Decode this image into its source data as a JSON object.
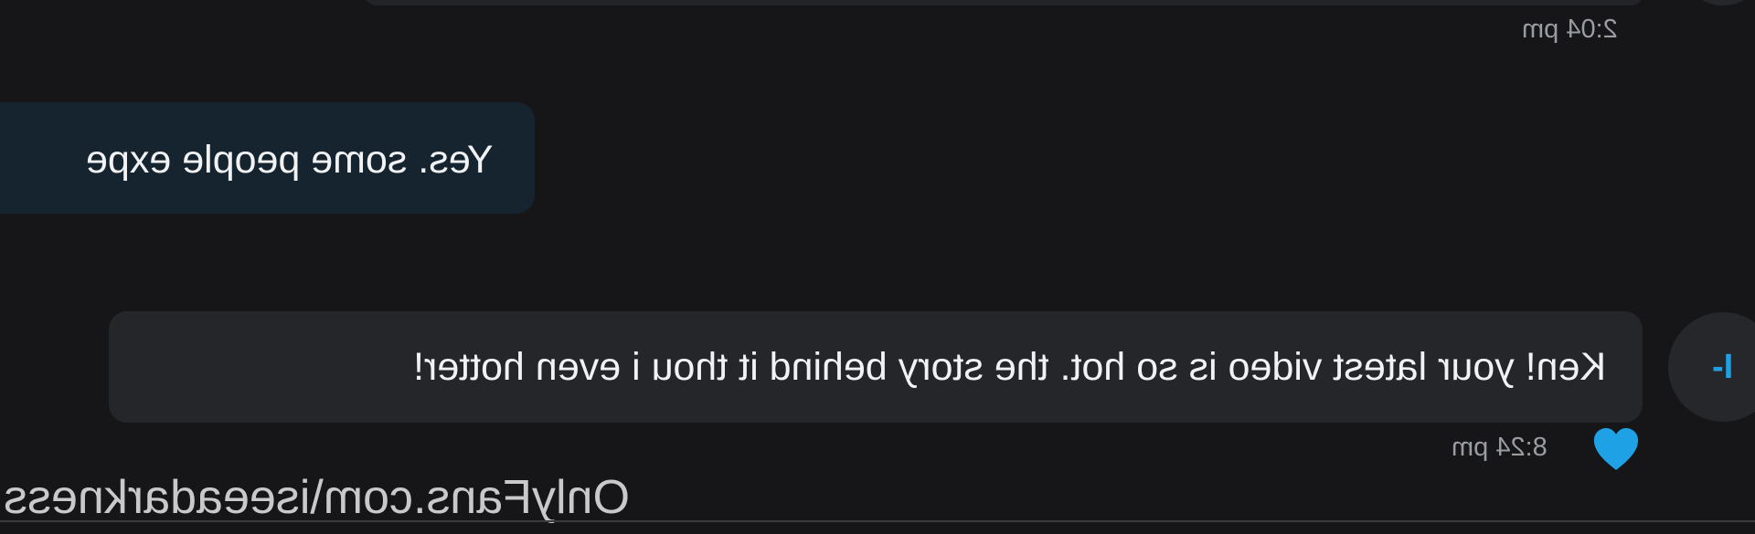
{
  "messages": [
    {
      "id": "earlier",
      "time": "2:04 pm"
    },
    {
      "id": "outgoing",
      "text": "Yes. some people expe"
    },
    {
      "id": "incoming",
      "sender_initials": "I-",
      "text": "Ken! your latest video is so hot. the story behind it thou i even hotter!",
      "time": "8:24 pm",
      "liked": true
    }
  ],
  "watermark": "OnlyFans.com\\iseeadarkness",
  "colors": {
    "background": "#161618",
    "incoming_bubble": "#25262a",
    "outgoing_bubble": "#16242f",
    "accent": "#1fa1e6",
    "timestamp": "#9a9ca3"
  },
  "icons": {
    "like": "heart-icon"
  }
}
